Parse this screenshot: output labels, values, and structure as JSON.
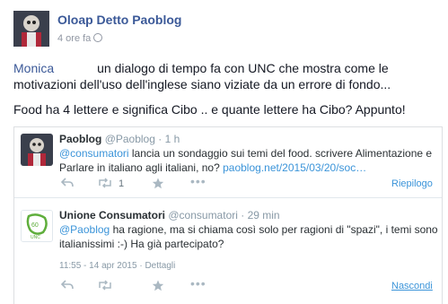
{
  "post": {
    "author": "Oloap Detto Paoblog",
    "time": "4 ore fa",
    "mention": "Monica",
    "text_line1_rest": "un dialogo di tempo fa con UNC che mostra come le",
    "text_line2": "motivazioni dell'uso dell'inglese siano viziate da un errore di fondo...",
    "text_para2": "Food ha 4 lettere e significa Cibo .. e quante lettere ha Cibo? Appunto!"
  },
  "tweet1": {
    "name": "Paoblog",
    "handle": "@Paoblog · 1 h",
    "mention": "@consumatori",
    "text_a": " lancia un sondaggio sui temi del food. scrivere Alimentazione e",
    "text_b": "Parlare in italiano agli italiani, no? ",
    "link": "paoblog.net/2015/03/20/soc…",
    "retweet_count": "1",
    "summary_label": "Riepilogo"
  },
  "tweet2": {
    "name": "Unione Consumatori",
    "handle": "@consumatori · 29 min",
    "mention": "@Paoblog",
    "text_a": " ha ragione, ma si chiama così solo per ragioni di \"spazi\", i temi sono",
    "text_b": "italianissimi :-)  Ha già partecipato?",
    "timestamp": "11:55 - 14 apr 2015",
    "details_label": "Dettagli",
    "hide_label": "Nascondi",
    "avatar_text": "UNC"
  },
  "icons": {
    "reply": "reply-icon",
    "retweet": "retweet-icon",
    "favorite": "star-icon",
    "more": "more-icon"
  },
  "colors": {
    "fb_blue": "#3b5998",
    "tw_link": "#3b94d9",
    "unc_green": "#5fae3c"
  }
}
